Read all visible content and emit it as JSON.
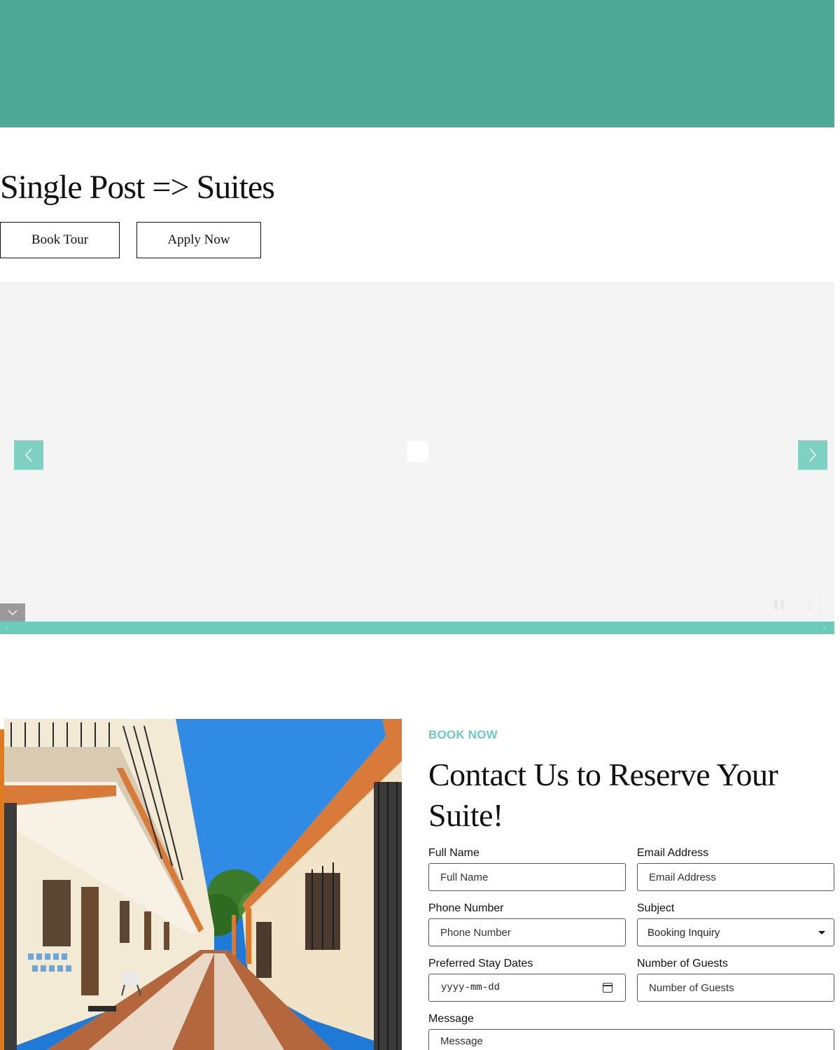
{
  "page": {
    "title": "Single Post => Suites",
    "buttons": {
      "book_tour": "Book Tour",
      "apply_now": "Apply Now"
    }
  },
  "slider": {
    "prev_icon": "chevron-left-icon",
    "next_icon": "chevron-right-icon",
    "thumbs_toggle_icon": "chevron-down-icon",
    "pause_icon": "pause-icon",
    "fullscreen_icon": "fullscreen-icon"
  },
  "colors": {
    "header_band": "#4ea896",
    "accent": "#6ccbbb",
    "slider_background": "#f4f4f4"
  },
  "booking": {
    "eyebrow": "BOOK NOW",
    "heading": "Contact Us to Reserve Your Suite!",
    "fields": {
      "full_name": {
        "label": "Full Name",
        "placeholder": "Full Name"
      },
      "email": {
        "label": "Email Address",
        "placeholder": "Email Address"
      },
      "phone": {
        "label": "Phone Number",
        "placeholder": "Phone Number"
      },
      "subject": {
        "label": "Subject",
        "value": "Booking Inquiry"
      },
      "dates": {
        "label": "Preferred Stay Dates",
        "placeholder": "yyyy-mm-dd"
      },
      "guests": {
        "label": "Number of Guests",
        "placeholder": "Number of Guests"
      },
      "message": {
        "label": "Message",
        "placeholder": "Message"
      }
    }
  }
}
